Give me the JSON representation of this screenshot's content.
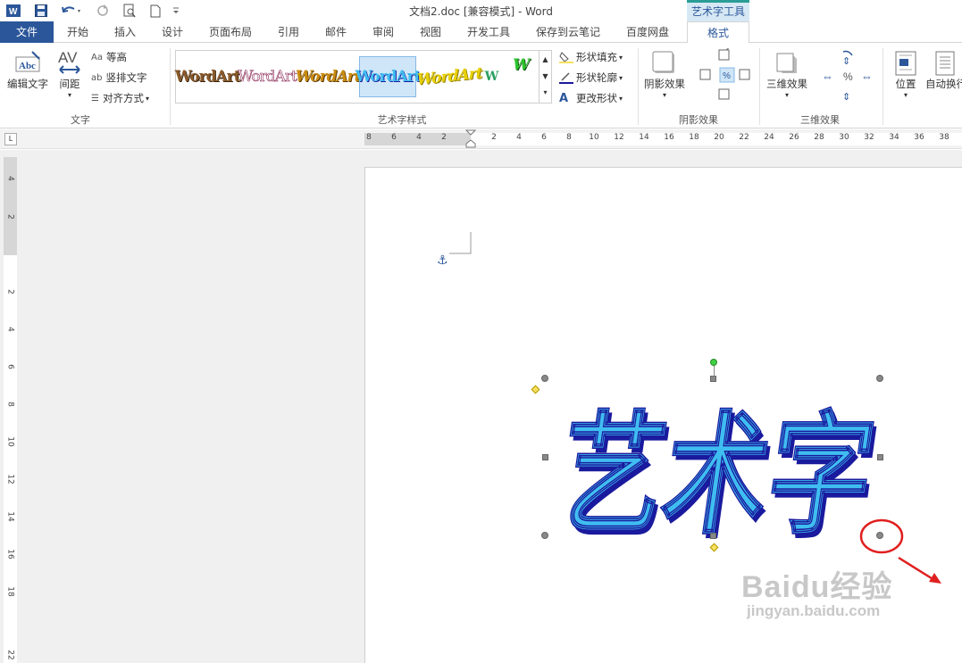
{
  "window": {
    "title": "文档2.doc [兼容模式] - Word",
    "contextual_tool_title": "艺术字工具"
  },
  "tabs": [
    "文件",
    "开始",
    "插入",
    "设计",
    "页面布局",
    "引用",
    "邮件",
    "审阅",
    "视图",
    "开发工具",
    "保存到云笔记",
    "百度网盘",
    "格式"
  ],
  "ribbon": {
    "text_group": {
      "label": "文字",
      "edit_text": "编辑文字",
      "spacing": "间距",
      "even_height": "等高",
      "vertical_text": "竖排文字",
      "align": "对齐方式"
    },
    "wordart_styles_group": {
      "label": "艺术字样式",
      "samples": [
        "WordArt",
        "WordArt",
        "WordArt",
        "WordArt",
        "WordArt",
        "W",
        "W"
      ],
      "shape_fill": "形状填充",
      "shape_outline": "形状轮廓",
      "change_shape": "更改形状"
    },
    "shadow_group": {
      "label": "阴影效果",
      "button": "阴影效果"
    },
    "threed_group": {
      "label": "三维效果",
      "button": "三维效果"
    },
    "arrange_group": {
      "position": "位置",
      "auto_wrap": "自动换行"
    }
  },
  "ruler": {
    "horizontal": [
      "8",
      "6",
      "4",
      "2",
      "2",
      "4",
      "6",
      "8",
      "10",
      "12",
      "14",
      "16",
      "18",
      "20",
      "22",
      "24",
      "26",
      "28",
      "30",
      "32",
      "34",
      "36",
      "38"
    ],
    "vertical": [
      "4",
      "2",
      "2",
      "4",
      "6",
      "8",
      "10",
      "12",
      "14",
      "16",
      "18",
      "22"
    ]
  },
  "document": {
    "wordart_text": "艺术字",
    "wordart_colors": {
      "fill": "#3fbdf0",
      "shadow": "#1a1a9e",
      "outline": "#1a1a9e"
    }
  },
  "watermark": {
    "logo": "Baidu经验",
    "url": "jingyan.baidu.com"
  },
  "colors": {
    "accent": "#2b579a",
    "annotation": "#e02020"
  }
}
